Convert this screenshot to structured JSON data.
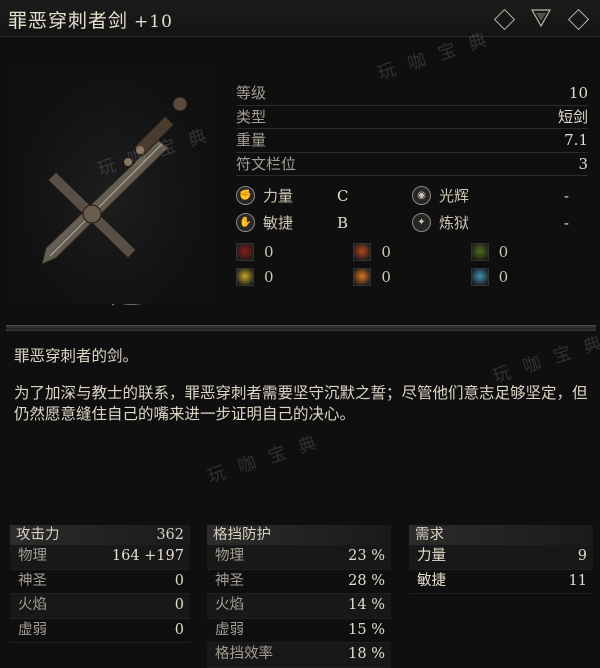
{
  "title": {
    "name": "罪恶穿刺者剑",
    "level": "+10"
  },
  "watermark": "玩 咖 宝 典",
  "stats": [
    {
      "label": "等级",
      "value": "10"
    },
    {
      "label": "类型",
      "value": "短剑"
    },
    {
      "label": "重量",
      "value": "7.1"
    },
    {
      "label": "符文栏位",
      "value": "3"
    }
  ],
  "scaling": [
    {
      "label": "力量",
      "grade": "C",
      "icon": "strength-icon"
    },
    {
      "label": "光辉",
      "grade": "-",
      "icon": "radiance-icon"
    },
    {
      "label": "敏捷",
      "grade": "B",
      "icon": "dexterity-icon"
    },
    {
      "label": "炼狱",
      "grade": "-",
      "icon": "inferno-icon"
    }
  ],
  "resistances": [
    {
      "value": "0",
      "color": "#8a1f1a",
      "icon": "blood-resist-icon"
    },
    {
      "value": "0",
      "color": "#b3461c",
      "icon": "fire-resist-icon"
    },
    {
      "value": "0",
      "color": "#4d6b1f",
      "icon": "poison-resist-icon"
    },
    {
      "value": "0",
      "color": "#c9a52a",
      "icon": "light-resist-icon"
    },
    {
      "value": "0",
      "color": "#d9771f",
      "icon": "burn-resist-icon"
    },
    {
      "value": "0",
      "color": "#3c8fb3",
      "icon": "frost-resist-icon"
    }
  ],
  "description": {
    "line1": "罪恶穿刺者的剑。",
    "line2": "为了加深与教士的联系，罪恶穿刺者需要坚守沉默之誓；尽管他们意志足够坚定，但仍然愿意缝住自己的嘴来进一步证明自己的决心。"
  },
  "attack": {
    "header": "攻击力",
    "total": "362",
    "rows": [
      {
        "label": "物理",
        "value": "164 +197"
      },
      {
        "label": "神圣",
        "value": "0"
      },
      {
        "label": "火焰",
        "value": "0"
      },
      {
        "label": "虚弱",
        "value": "0"
      }
    ]
  },
  "guard": {
    "header": "格挡防护",
    "rows": [
      {
        "label": "物理",
        "value": "23 %"
      },
      {
        "label": "神圣",
        "value": "28 %"
      },
      {
        "label": "火焰",
        "value": "14 %"
      },
      {
        "label": "虚弱",
        "value": "15 %"
      },
      {
        "label": "格挡效率",
        "value": "18 %"
      }
    ]
  },
  "requirements": {
    "header": "需求",
    "rows": [
      {
        "label": "力量",
        "value": "9"
      },
      {
        "label": "敏捷",
        "value": "11"
      }
    ]
  }
}
